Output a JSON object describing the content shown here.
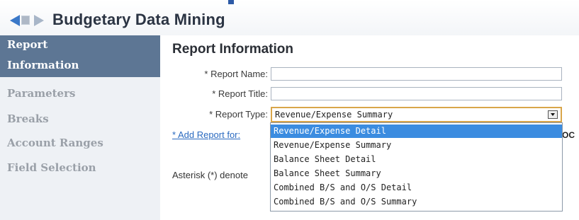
{
  "header": {
    "title": "Budgetary Data Mining"
  },
  "sidebar": {
    "items": [
      {
        "label": "Report",
        "label2": "Information"
      },
      {
        "label": "Parameters"
      },
      {
        "label": "Breaks"
      },
      {
        "label": "Account Ranges"
      },
      {
        "label": "Field Selection"
      }
    ]
  },
  "main": {
    "section_title": "Report Information",
    "fields": {
      "report_name": {
        "label": "* Report Name:",
        "value": ""
      },
      "report_title": {
        "label": "* Report Title:",
        "value": ""
      },
      "report_type": {
        "label": "* Report Type:",
        "value": "Revenue/Expense Summary"
      }
    },
    "add_link": "* Add Report for:",
    "cut_text": "OC",
    "asterisk_note": "Asterisk (*) denote",
    "dropdown_options": [
      "Revenue/Expense Detail",
      "Revenue/Expense Summary",
      "Balance Sheet Detail",
      "Balance Sheet Summary",
      "Combined B/S and O/S Detail",
      "Combined B/S and O/S Summary"
    ],
    "dropdown_selected_index": 0
  },
  "colors": {
    "accent": "#3b8ce0",
    "sidebar_active": "#5d7694",
    "focus_border": "#d9a64a",
    "link": "#2a6ac0"
  },
  "icons": [
    "back-arrow-icon",
    "page-icon",
    "forward-arrow-icon",
    "dropdown-arrow-icon"
  ]
}
